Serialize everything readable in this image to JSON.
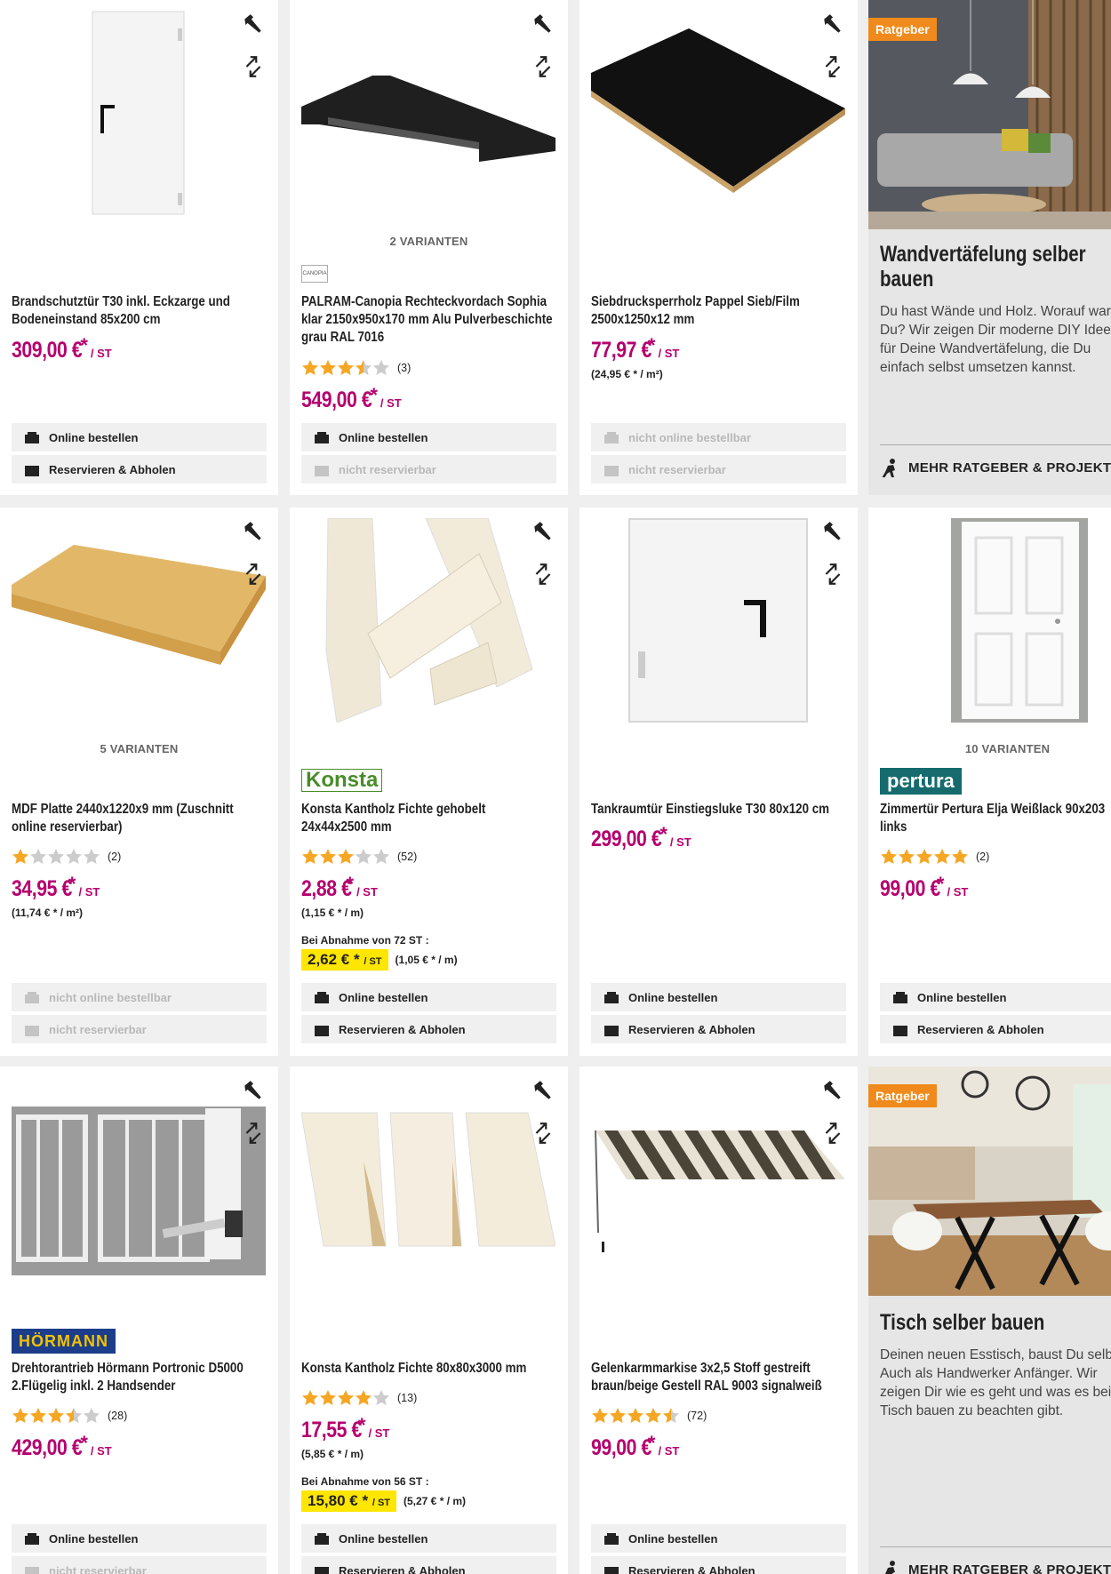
{
  "colors": {
    "price": "#b5006e",
    "highlight": "#ffe600",
    "badge": "#f08a1c",
    "star": "#f5a623",
    "star_empty": "#cccccc"
  },
  "products": [
    {
      "name": "Brandschutztür T30 inkl. Eckzarge und Bodeneinstand 85x200 cm",
      "price": "309,00 €",
      "unit": "/ ST",
      "order": "Online bestellen",
      "reserve": "Reservieren & Abholen"
    },
    {
      "variants": "2 VARIANTEN",
      "brand": "CANOPIA",
      "name": "PALRAM-Canopia Rechteckvordach Sophia klar 2150x950x170 mm Alu Pulverbeschichte grau RAL 7016",
      "rating": 3.5,
      "rating_count": "(3)",
      "price": "549,00 €",
      "unit": "/ ST",
      "order": "Online bestellen",
      "reserve": "nicht reservierbar"
    },
    {
      "name": "Siebdrucksperrholz Pappel Sieb/Film 2500x1250x12 mm",
      "price": "77,97 €",
      "unit": "/ ST",
      "unit_price": "(24,95 € * / m²)",
      "order": "nicht online bestellbar",
      "reserve": "nicht reservierbar"
    },
    {
      "variants": "5 VARIANTEN",
      "name": "MDF Platte 2440x1220x9 mm (Zuschnitt online reservierbar)",
      "rating": 1,
      "rating_count": "(2)",
      "price": "34,95 €",
      "unit": "/ ST",
      "unit_price": "(11,74 € * / m²)",
      "order": "nicht online bestellbar",
      "reserve": "nicht reservierbar"
    },
    {
      "brand": "Konsta",
      "name": "Konsta Kantholz Fichte gehobelt 24x44x2500 mm",
      "rating": 3,
      "rating_count": "(52)",
      "price": "2,88 €",
      "unit": "/ ST",
      "unit_price": "(1,15 € * / m)",
      "bulk_label": "Bei Abnahme von 72 ST :",
      "bulk_price": "2,62 €",
      "bulk_unit": "/ ST",
      "bulk_unit_price": "(1,05 € * / m)",
      "order": "Online bestellen",
      "reserve": "Reservieren & Abholen"
    },
    {
      "name": "Tankraumtür Einstiegsluke T30 80x120 cm",
      "price": "299,00 €",
      "unit": "/ ST",
      "order": "Online bestellen",
      "reserve": "Reservieren & Abholen"
    },
    {
      "variants": "10 VARIANTEN",
      "brand": "pertura",
      "name": "Zimmertür Pertura Elja Weißlack 90x203 links",
      "rating": 5,
      "rating_count": "(2)",
      "price": "99,00 €",
      "unit": "/ ST",
      "order": "Online bestellen",
      "reserve": "Reservieren & Abholen"
    },
    {
      "brand": "HÖRMANN",
      "name": "Drehtorantrieb Hörmann Portronic D5000 2.Flügelig inkl. 2 Handsender",
      "rating": 3.5,
      "rating_count": "(28)",
      "price": "429,00 €",
      "unit": "/ ST",
      "order": "Online bestellen",
      "reserve": "nicht reservierbar"
    },
    {
      "name": "Konsta Kantholz Fichte 80x80x3000 mm",
      "rating": 4,
      "rating_count": "(13)",
      "price": "17,55 €",
      "unit": "/ ST",
      "unit_price": "(5,85 € * / m)",
      "bulk_label": "Bei Abnahme von 56 ST :",
      "bulk_price": "15,80 €",
      "bulk_unit": "/ ST",
      "bulk_unit_price": "(5,27 € * / m)",
      "order": "Online bestellen",
      "reserve": "Reservieren & Abholen"
    },
    {
      "name": "Gelenkarmmarkise 3x2,5 Stoff gestreift braun/beige Gestell RAL 9003 signalweiß",
      "rating": 4.5,
      "rating_count": "(72)",
      "price": "99,00 €",
      "unit": "/ ST",
      "order": "Online bestellen",
      "reserve": "Reservieren & Abholen"
    }
  ],
  "ratgeber": [
    {
      "badge": "Ratgeber",
      "title": "Wandvertäfelung selber bauen",
      "text": "Du hast Wände und Holz. Worauf wartest Du? Wir zeigen Dir moderne DIY Ideen für Deine Wandvertäfelung, die Du einfach selbst umsetzen kannst.",
      "link": "MEHR RATGEBER & PROJEKTE"
    },
    {
      "badge": "Ratgeber",
      "title": "Tisch selber bauen",
      "text": "Deinen neuen Esstisch, baust Du selbst. Auch als Handwerker Anfänger. Wir zeigen Dir wie es geht und was es beim Tisch bauen zu beachten gibt.",
      "link": "MEHR RATGEBER & PROJEKTE"
    }
  ],
  "price_star": "*"
}
